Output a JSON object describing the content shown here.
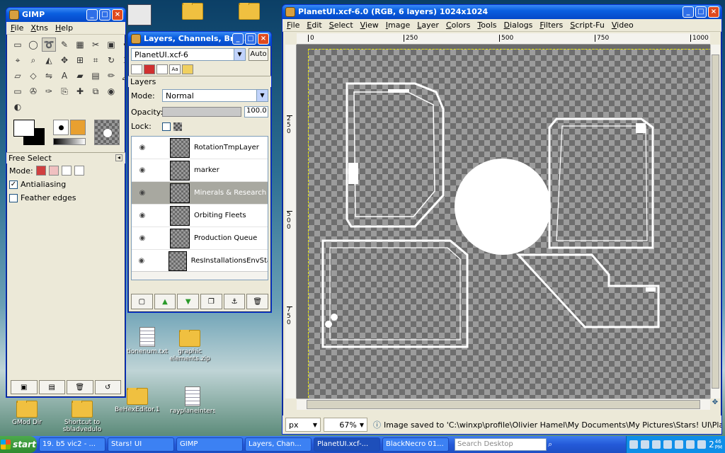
{
  "desktop": {
    "icons": [
      {
        "label": "tionenum.txt",
        "type": "text"
      },
      {
        "label": "graphic elements.zip",
        "type": "zip"
      },
      {
        "label": "GMod Dir",
        "type": "folder"
      },
      {
        "label": "Shortcut to sbladvedulo",
        "type": "folder"
      },
      {
        "label": "BeHexEditor.130",
        "type": "folder"
      },
      {
        "label": "rayplaneintersec...",
        "type": "text"
      }
    ]
  },
  "toolbox": {
    "title": "GIMP",
    "menu": [
      "File",
      "Xtns",
      "Help"
    ],
    "tool_options_title": "Free Select",
    "mode_label": "Mode:",
    "antialiasing_label": "Antialiasing",
    "antialiasing_checked": true,
    "feather_label": "Feather edges",
    "feather_checked": false,
    "tools": [
      "rect-select-icon",
      "ellipse-select-icon",
      "free-select-icon",
      "fuzzy-select-icon",
      "color-select-icon",
      "scissors-icon",
      "foreground-select-icon",
      "paths-icon",
      "color-picker-icon",
      "zoom-icon",
      "measure-icon",
      "move-icon",
      "align-icon",
      "crop-icon",
      "rotate-icon",
      "scale-icon",
      "shear-icon",
      "perspective-icon",
      "flip-icon",
      "text-icon",
      "bucket-fill-icon",
      "blend-icon",
      "pencil-icon",
      "paintbrush-icon",
      "eraser-icon",
      "airbrush-icon",
      "ink-icon",
      "clone-icon",
      "heal-icon",
      "perspective-clone-icon",
      "blur-icon",
      "smudge-icon",
      "dodge-icon"
    ]
  },
  "layers_dialog": {
    "title": "Layers, Channels, Brus...",
    "image_select": "PlanetUI.xcf-6",
    "auto_label": "Auto",
    "panel_title": "Layers",
    "mode_label": "Mode:",
    "mode_value": "Normal",
    "opacity_label": "Opacity:",
    "opacity_value": "100.0",
    "opacity_fraction": 1.0,
    "lock_label": "Lock:",
    "layers": [
      {
        "name": "RotationTmpLayer",
        "active": false
      },
      {
        "name": "marker",
        "active": false
      },
      {
        "name": "Minerals & Research",
        "active": true
      },
      {
        "name": "Orbiting Fleets",
        "active": false
      },
      {
        "name": "Production Queue",
        "active": false
      },
      {
        "name": "ResInstallationsEnvStar",
        "active": false
      }
    ]
  },
  "image_window": {
    "title": "PlanetUI.xcf-6.0 (RGB, 6 layers) 1024x1024",
    "menu": [
      "File",
      "Edit",
      "Select",
      "View",
      "Image",
      "Layer",
      "Colors",
      "Tools",
      "Dialogs",
      "Filters",
      "Script-Fu",
      "Video"
    ],
    "ruler_h": [
      "0",
      "250",
      "500",
      "750",
      "1000"
    ],
    "ruler_v": [
      "250",
      "500",
      "750"
    ],
    "unit": "px",
    "zoom": "67%",
    "status": "Image saved to 'C:\\winxp\\profile\\Olivier Hamel\\My Documents\\My Pictures\\Stars! UI\\PlanetU..."
  },
  "taskbar": {
    "start_label": "start",
    "tasks": [
      {
        "label": "19. b5 vic2 - ...",
        "active": false
      },
      {
        "label": "Stars! UI",
        "active": false
      },
      {
        "label": "GIMP",
        "active": false
      },
      {
        "label": "Layers, Chan...",
        "active": false
      },
      {
        "label": "PlanetUI.xcf-...",
        "active": true
      },
      {
        "label": "BlackNecro 01...",
        "active": false
      }
    ],
    "search_placeholder": "Search Desktop",
    "clock_hour": "2",
    "clock_min": "46",
    "clock_ampm": "PM"
  }
}
